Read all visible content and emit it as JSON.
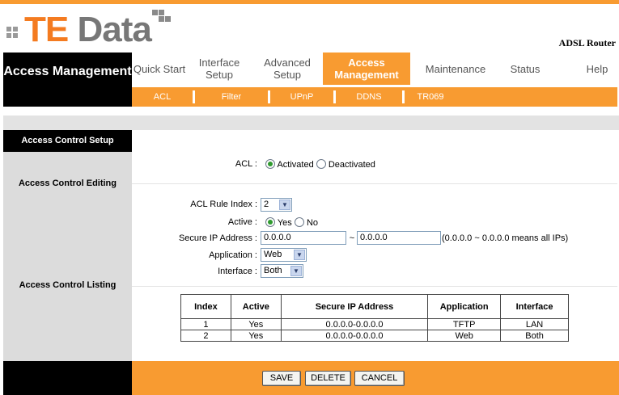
{
  "header": {
    "logo_te": "TE",
    "logo_data": "Data",
    "product": "ADSL Router"
  },
  "section_title": "Access Management",
  "nav": {
    "items": [
      {
        "label": "Quick Start"
      },
      {
        "label": "Interface Setup"
      },
      {
        "label": "Advanced Setup"
      },
      {
        "label": "Access Management",
        "active": true
      },
      {
        "label": "Maintenance"
      },
      {
        "label": "Status"
      },
      {
        "label": "Help"
      }
    ],
    "subitems": [
      {
        "label": "ACL"
      },
      {
        "label": "Filter"
      },
      {
        "label": "UPnP"
      },
      {
        "label": "DDNS"
      },
      {
        "label": "TR069"
      }
    ]
  },
  "sidebar": {
    "setup": "Access Control Setup",
    "editing": "Access Control Editing",
    "listing": "Access Control Listing"
  },
  "form": {
    "acl_label": "ACL :",
    "acl_activated": "Activated",
    "acl_deactivated": "Deactivated",
    "acl_value": "Activated",
    "rule_index_label": "ACL Rule Index :",
    "rule_index_value": "2",
    "active_label": "Active :",
    "active_yes": "Yes",
    "active_no": "No",
    "active_value": "Yes",
    "secure_ip_label": "Secure IP Address :",
    "ip_start": "0.0.0.0",
    "ip_sep": "~",
    "ip_end": "0.0.0.0",
    "ip_hint": "(0.0.0.0 ~ 0.0.0.0 means all IPs)",
    "application_label": "Application :",
    "application_value": "Web",
    "interface_label": "Interface :",
    "interface_value": "Both"
  },
  "table": {
    "headers": [
      "Index",
      "Active",
      "Secure IP Address",
      "Application",
      "Interface"
    ],
    "rows": [
      [
        "1",
        "Yes",
        "0.0.0.0-0.0.0.0",
        "TFTP",
        "LAN"
      ],
      [
        "2",
        "Yes",
        "0.0.0.0-0.0.0.0",
        "Web",
        "Both"
      ]
    ]
  },
  "buttons": {
    "save": "SAVE",
    "delete": "DELETE",
    "cancel": "CANCEL"
  },
  "colors": {
    "accent_orange": "#f89b31",
    "logo_orange": "#f47b20",
    "black": "#000000",
    "sidebar_gray": "#dcdcdc"
  }
}
